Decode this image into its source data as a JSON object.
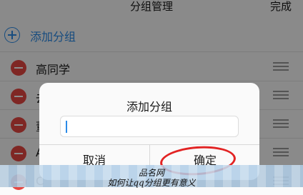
{
  "header": {
    "title": "分组管理",
    "done_label": "完成"
  },
  "add_group": {
    "label": "添加分组"
  },
  "groups": [
    {
      "name": "高同学"
    },
    {
      "name": "去"
    },
    {
      "name": "董"
    },
    {
      "name": "A"
    },
    {
      "name": "C"
    }
  ],
  "dialog": {
    "title": "添加分组",
    "input_value": "",
    "cancel_label": "取消",
    "confirm_label": "确定"
  },
  "watermark": {
    "line1": "品名网",
    "line2": "如何让qq分组更有意义"
  },
  "colors": {
    "accent": "#2b8be8",
    "delete": "#e74843",
    "highlight_ring": "#e22323"
  }
}
